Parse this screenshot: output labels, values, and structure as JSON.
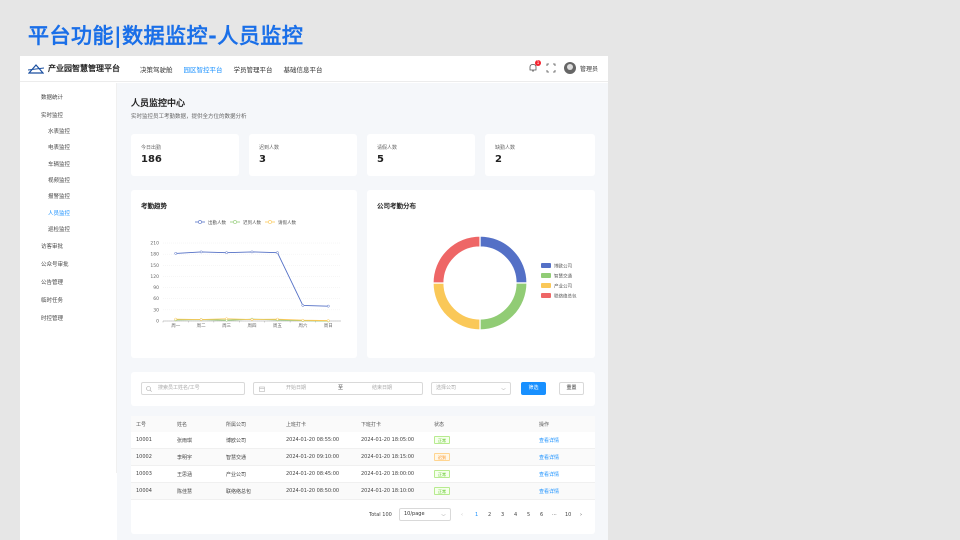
{
  "slide_title": "平台功能|数据监控-人员监控",
  "app": {
    "brand": "产业园智慧管理平台",
    "nav": [
      "决策驾驶舱",
      "园区智控平台",
      "学员管理平台",
      "基础信息平台"
    ],
    "active_nav_index": 1,
    "notification_count": "1",
    "username": "管理员"
  },
  "sidebar": {
    "items": [
      "数据统计",
      "实时监控",
      "水表监控",
      "电表监控",
      "车辆监控",
      "视频监控",
      "报警监控",
      "人员监控",
      "巡检监控",
      "访客审批",
      "公众号审批",
      "公告管理",
      "临时任务",
      "时控管理"
    ]
  },
  "page": {
    "title": "人员监控中心",
    "subtitle": "实时监控员工考勤数据，提供全方位的数据分析"
  },
  "stats": [
    {
      "label": "今日出勤",
      "value": "186"
    },
    {
      "label": "迟到人数",
      "value": "3"
    },
    {
      "label": "请假人数",
      "value": "5"
    },
    {
      "label": "缺勤人数",
      "value": "2"
    }
  ],
  "trend_chart": {
    "title": "考勤趋势",
    "chart_data": {
      "type": "line",
      "categories": [
        "周一",
        "周二",
        "周三",
        "周四",
        "周五",
        "周六",
        "周日"
      ],
      "series": [
        {
          "name": "出勤人数",
          "color": "#5470c6",
          "values": [
            182,
            186,
            184,
            186,
            184,
            42,
            40
          ]
        },
        {
          "name": "迟到人数",
          "color": "#91cc75",
          "values": [
            3,
            4,
            2,
            5,
            3,
            1,
            0
          ]
        },
        {
          "name": "请假人数",
          "color": "#fac858",
          "values": [
            5,
            4,
            6,
            4,
            5,
            2,
            1
          ]
        }
      ],
      "ylim": [
        0,
        210
      ],
      "yticks": [
        "0",
        "30",
        "60",
        "90",
        "120",
        "150",
        "180",
        "210"
      ]
    }
  },
  "pie_chart": {
    "title": "公司考勤分布",
    "chart_data": {
      "type": "pie",
      "donut": true,
      "slices": [
        {
          "name": "博欧公司",
          "value": 25,
          "color": "#5470c6"
        },
        {
          "name": "智慧交通",
          "value": 25,
          "color": "#91cc75"
        },
        {
          "name": "产业公司",
          "value": 25,
          "color": "#fac858"
        },
        {
          "name": "联络络总包",
          "value": 25,
          "color": "#ee6666"
        }
      ],
      "legend_position": "right"
    }
  },
  "filters": {
    "search_placeholder": "搜索员工姓名/工号",
    "start_placeholder": "开始日期",
    "range_sep": "至",
    "end_placeholder": "结束日期",
    "company_placeholder": "选择公司",
    "filter_btn": "筛选",
    "reset_btn": "重置"
  },
  "table": {
    "headers": [
      "工号",
      "姓名",
      "所属公司",
      "上班打卡",
      "下班打卡",
      "状态",
      "操作"
    ],
    "rows": [
      {
        "id": "10001",
        "name": "张雨琪",
        "company": "博欧公司",
        "in": "2024-01-20 08:55:00",
        "out": "2024-01-20 18:05:00",
        "status": "正常",
        "status_type": "ok",
        "action": "查看详情"
      },
      {
        "id": "10002",
        "name": "李明宇",
        "company": "智慧交通",
        "in": "2024-01-20 09:10:00",
        "out": "2024-01-20 18:15:00",
        "status": "迟到",
        "status_type": "late",
        "action": "查看详情"
      },
      {
        "id": "10003",
        "name": "王思涵",
        "company": "产业公司",
        "in": "2024-01-20 08:45:00",
        "out": "2024-01-20 18:00:00",
        "status": "正常",
        "status_type": "ok",
        "action": "查看详情"
      },
      {
        "id": "10004",
        "name": "陈佳慧",
        "company": "联络络总包",
        "in": "2024-01-20 08:50:00",
        "out": "2024-01-20 18:10:00",
        "status": "正常",
        "status_type": "ok",
        "action": "查看详情"
      }
    ]
  },
  "pagination": {
    "total": "Total 100",
    "page_size": "10/page",
    "pages": [
      "1",
      "2",
      "3",
      "4",
      "5",
      "6",
      "···",
      "10"
    ],
    "prev": "‹",
    "next": "›"
  }
}
